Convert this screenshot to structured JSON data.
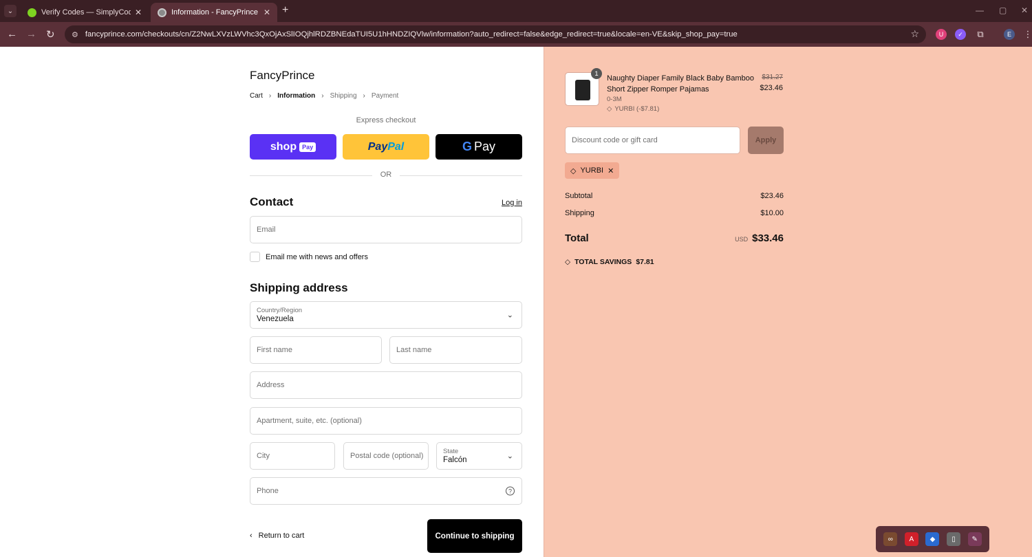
{
  "browser": {
    "tabs": [
      {
        "title": "Verify Codes — SimplyCodes",
        "active": false
      },
      {
        "title": "Information - FancyPrince - Che",
        "active": true
      }
    ],
    "url": "fancyprince.com/checkouts/cn/Z2NwLXVzLWVhc3QxOjAxSlIOQjhlRDZBNEdaTUI5U1hHNDZIQVlw/information?auto_redirect=false&edge_redirect=true&locale=en-VE&skip_shop_pay=true",
    "profile_initial": "E"
  },
  "checkout": {
    "store_name": "FancyPrince",
    "breadcrumbs": [
      "Cart",
      "Information",
      "Shipping",
      "Payment"
    ],
    "express_label": "Express checkout",
    "shop_pay_label": "shop",
    "shop_pay_pill": "Pay",
    "paypal_label_1": "Pay",
    "paypal_label_2": "Pal",
    "gpay_g": "G",
    "gpay_label": "Pay",
    "or_label": "OR",
    "contact_heading": "Contact",
    "login_label": "Log in",
    "email_placeholder": "Email",
    "newsletter_label": "Email me with news and offers",
    "shipping_heading": "Shipping address",
    "country_label": "Country/Region",
    "country_value": "Venezuela",
    "first_name_placeholder": "First name",
    "last_name_placeholder": "Last name",
    "address_placeholder": "Address",
    "apartment_placeholder": "Apartment, suite, etc. (optional)",
    "city_placeholder": "City",
    "postal_placeholder": "Postal code (optional)",
    "state_label": "State",
    "state_value": "Falcón",
    "phone_placeholder": "Phone",
    "return_label": "Return to cart",
    "continue_label": "Continue to shipping"
  },
  "summary": {
    "product": {
      "quantity": "1",
      "name": "Naughty Diaper Family Black Baby Bamboo Short Zipper Romper Pajamas",
      "variant": "0-3M",
      "discount_tag": "YURBI (-$7.81)",
      "original_price": "$31.27",
      "price": "$23.46"
    },
    "discount_placeholder": "Discount code or gift card",
    "apply_label": "Apply",
    "applied_code": "YURBI",
    "subtotal_label": "Subtotal",
    "subtotal_value": "$23.46",
    "shipping_label": "Shipping",
    "shipping_value": "$10.00",
    "total_label": "Total",
    "currency": "USD",
    "total_value": "$33.46",
    "savings_label": "TOTAL SAVINGS",
    "savings_value": "$7.81"
  },
  "theme": {
    "chrome_dark": "#3a1f24",
    "chrome_toolbar": "#5a3038",
    "summary_bg": "#f9c6b1",
    "shop_pay": "#5a31f4",
    "paypal": "#ffc439"
  }
}
